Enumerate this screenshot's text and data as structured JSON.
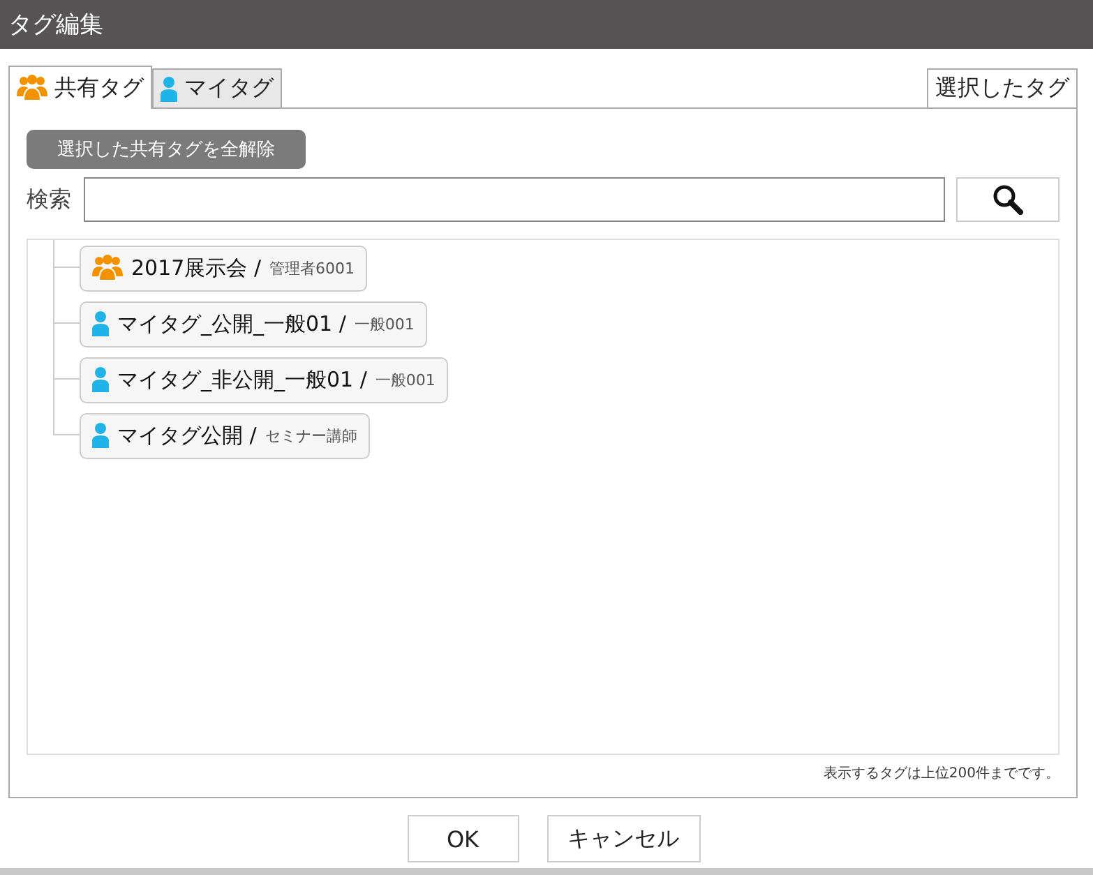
{
  "window": {
    "title": "タグ編集"
  },
  "tabs": [
    {
      "label": "共有タグ",
      "kind": "shared",
      "selected": true
    },
    {
      "label": "マイタグ",
      "kind": "personal",
      "selected": false
    }
  ],
  "side_tab": {
    "label": "選択したタグ"
  },
  "clear_button": {
    "label": "選択した共有タグを全解除"
  },
  "search": {
    "label": "検索"
  },
  "tags": [
    {
      "name": "2017展示会",
      "kind": "shared",
      "separator": "/",
      "owner": "管理者6001"
    },
    {
      "name": "マイタグ_公開_一般01",
      "kind": "personal",
      "separator": "/",
      "owner": "一般001"
    },
    {
      "name": "マイタグ_非公開_一般01",
      "kind": "personal",
      "separator": "/",
      "owner": "一般001"
    },
    {
      "name": "マイタグ公開",
      "kind": "personal",
      "separator": "/",
      "owner": "セミナー講師"
    }
  ],
  "note": "表示するタグは上位200件までです。",
  "buttons": [
    "OK",
    "キャンセル"
  ]
}
